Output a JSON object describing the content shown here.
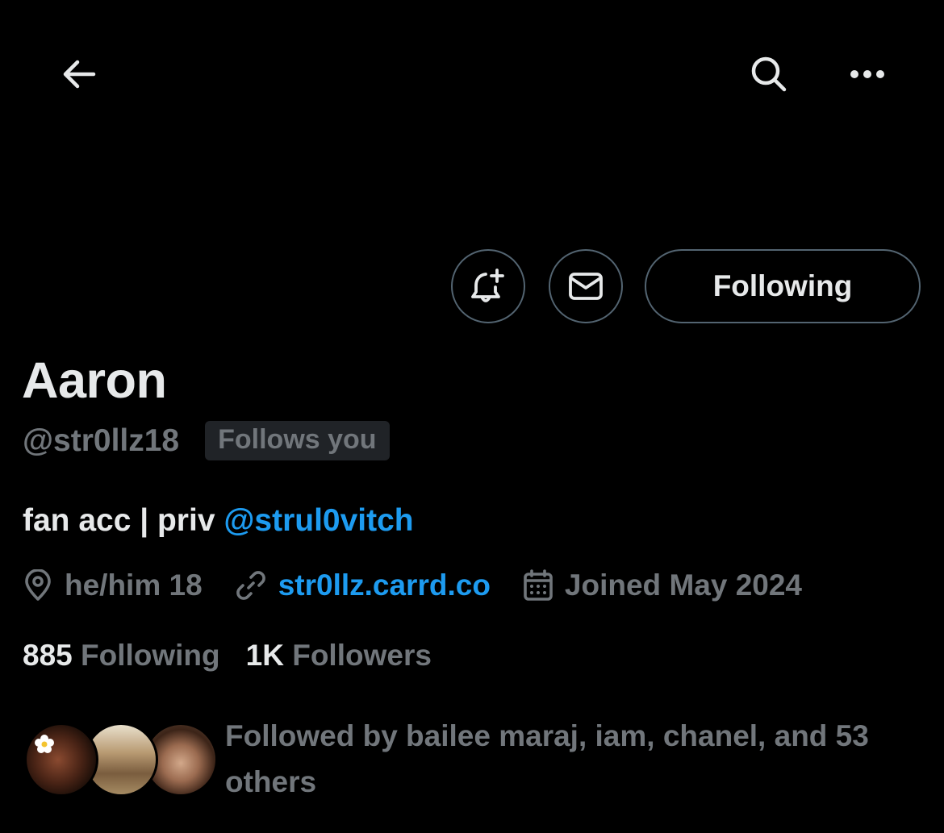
{
  "profile": {
    "display_name": "Aaron",
    "handle": "@str0llz18",
    "follows_you_badge": "Follows you",
    "bio_text": "fan acc | priv ",
    "bio_mention": "@strul0vitch",
    "pronouns_location": "he/him 18",
    "website": "str0llz.carrd.co",
    "joined": "Joined May 2024",
    "following_count": "885",
    "following_label": " Following",
    "followers_count": "1K",
    "followers_label": " Followers",
    "followed_by": "Followed by bailee maraj, iam, chanel, and 53 others"
  },
  "actions": {
    "following_button": "Following"
  },
  "icons": {
    "back": "arrow-left-icon",
    "search": "search-icon",
    "more": "more-horizontal-icon",
    "notify": "bell-plus-icon",
    "message": "envelope-icon",
    "location": "location-pin-icon",
    "link": "link-icon",
    "calendar": "calendar-icon"
  },
  "colors": {
    "background": "#000000",
    "primary_text": "#e7e9ea",
    "secondary_text": "#71767b",
    "accent": "#1d9bf0",
    "border": "#536471",
    "badge_bg": "#202327"
  }
}
